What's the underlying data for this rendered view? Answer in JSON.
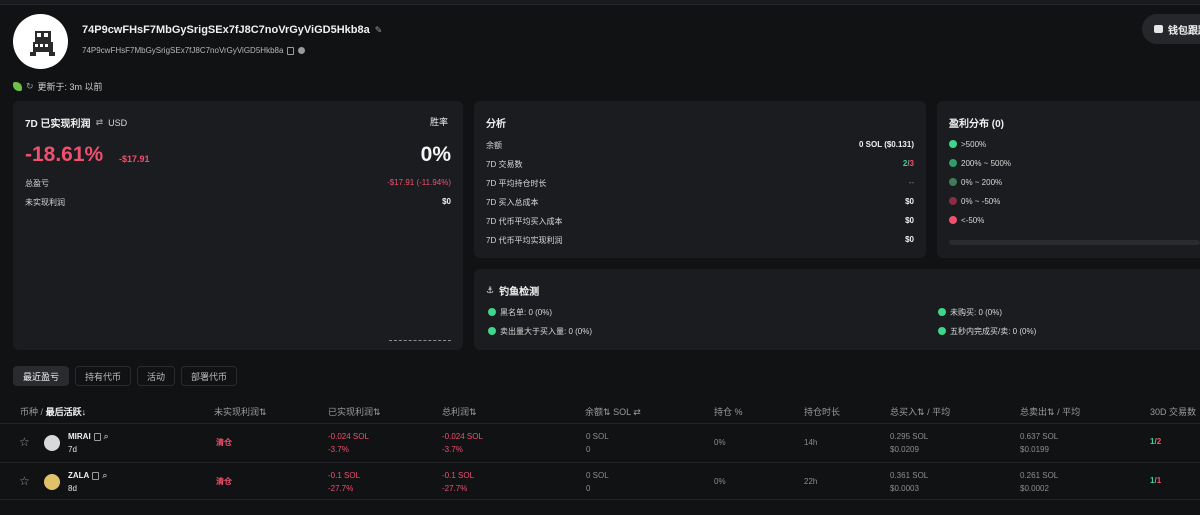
{
  "header": {
    "address": "74P9cwFHsF7MbGySrigSEx7fJ8C7noVrGyViGD5Hkb8a",
    "address_short": "74P9cwFHsF7MbGySrigSEx7fJ8C7noVrGyViGD5Hkb8a",
    "wallet_button": "钱包跟踪",
    "updated": "更新于: 3m 以前"
  },
  "pnl_card": {
    "title": "7D 已实现利润",
    "currency": "USD",
    "winrate_label": "胜率",
    "pnl_percent": "-18.61%",
    "pnl_usd": "-$17.91",
    "winrate_value": "0%",
    "total_label": "总盈亏",
    "total_value": "-$17.91 (-11.94%)",
    "unrealized_label": "未实现利润",
    "unrealized_value": "$0"
  },
  "analysis": {
    "title": "分析",
    "rows": [
      {
        "label": "余额",
        "value": "0 SOL ($0.131)"
      },
      {
        "label": "7D 交易数",
        "value_win": "2",
        "value_sep": "/",
        "value_loss": "3"
      },
      {
        "label": "7D 平均持仓时长",
        "value": "--"
      },
      {
        "label": "7D 买入总成本",
        "value": "$0"
      },
      {
        "label": "7D 代币平均买入成本",
        "value": "$0"
      },
      {
        "label": "7D 代币平均实现利润",
        "value": "$0"
      }
    ]
  },
  "distribution": {
    "title": "盈利分布 (0)",
    "items": [
      {
        "label": ">500%",
        "color": "#3fd68a"
      },
      {
        "label": "200% ~ 500%",
        "color": "#2f9e67"
      },
      {
        "label": "0% ~ 200%",
        "color": "#3e7d58"
      },
      {
        "label": "0% ~ -50%",
        "color": "#8a2c42"
      },
      {
        "label": "<-50%",
        "color": "#f0506e"
      }
    ]
  },
  "phishing": {
    "title": "钓鱼检测",
    "items": [
      {
        "label": "黑名单: 0 (0%)"
      },
      {
        "label": "未购买: 0 (0%)"
      },
      {
        "label": "卖出量大于买入量: 0 (0%)"
      },
      {
        "label": "五秒内完成买/卖: 0 (0%)"
      }
    ]
  },
  "tabs": [
    "最近盈亏",
    "持有代币",
    "活动",
    "部署代币"
  ],
  "table": {
    "headers": {
      "token": "币种",
      "token_sep": "/",
      "last_active": "最后活跃",
      "unrealized": "未实现利润",
      "realized": "已实现利润",
      "total": "总利润",
      "balance": "余额",
      "balance_unit": "SOL",
      "position": "持仓 %",
      "holding": "持仓时长",
      "bought": "总买入",
      "bought_avg": "/ 平均",
      "sold": "总卖出",
      "sold_avg": "/ 平均",
      "trades": "30D 交易数"
    },
    "rows": [
      {
        "name": "MIRAI",
        "age": "7d",
        "unrealized": "清仓",
        "realized": "-0.024 SOL",
        "realized_pct": "-3.7%",
        "total": "-0.024 SOL",
        "total_pct": "-3.7%",
        "balance": "0 SOL",
        "balance_sub": "0",
        "position": "0%",
        "holding": "14h",
        "bought": "0.295 SOL",
        "bought_avg": "$0.0209",
        "sold": "0.637 SOL",
        "sold_avg": "$0.0199",
        "trades_win": "1",
        "trades_sep": "/",
        "trades_loss": "2"
      },
      {
        "name": "ZALA",
        "age": "8d",
        "unrealized": "清仓",
        "realized": "-0.1 SOL",
        "realized_pct": "-27.7%",
        "total": "-0.1 SOL",
        "total_pct": "-27.7%",
        "balance": "0 SOL",
        "balance_sub": "0",
        "position": "0%",
        "holding": "22h",
        "bought": "0.361 SOL",
        "bought_avg": "$0.0003",
        "sold": "0.261 SOL",
        "sold_avg": "$0.0002",
        "trades_win": "1",
        "trades_sep": "/",
        "trades_loss": "1"
      }
    ]
  }
}
